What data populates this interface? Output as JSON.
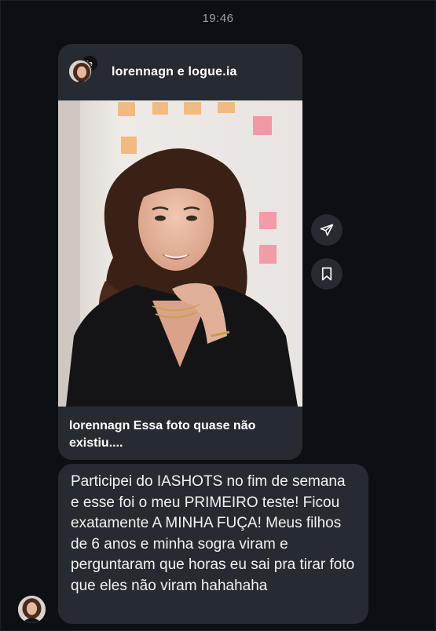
{
  "status": {
    "time": "19:46"
  },
  "post": {
    "authors": "lorennagn e logue.ia",
    "collab_badge": "ie",
    "caption": "lorennagn Essa foto quase não existiu....",
    "image_desc": "woman portrait photo"
  },
  "actions": {
    "share_icon": "paper-plane-icon",
    "save_icon": "bookmark-icon"
  },
  "message": {
    "text": "Participei do IASHOTS no fim de semana e esse foi o meu PRIMEIRO teste! Ficou exatamente A MINHA FUÇA! Meus filhos de 6 anos e minha sogra viram e perguntaram que horas eu sai pra tirar foto que eles não viram hahahaha"
  },
  "colors": {
    "background": "#0c0f14",
    "bubble": "#262a31",
    "timestamp": "#9aa0a8"
  }
}
